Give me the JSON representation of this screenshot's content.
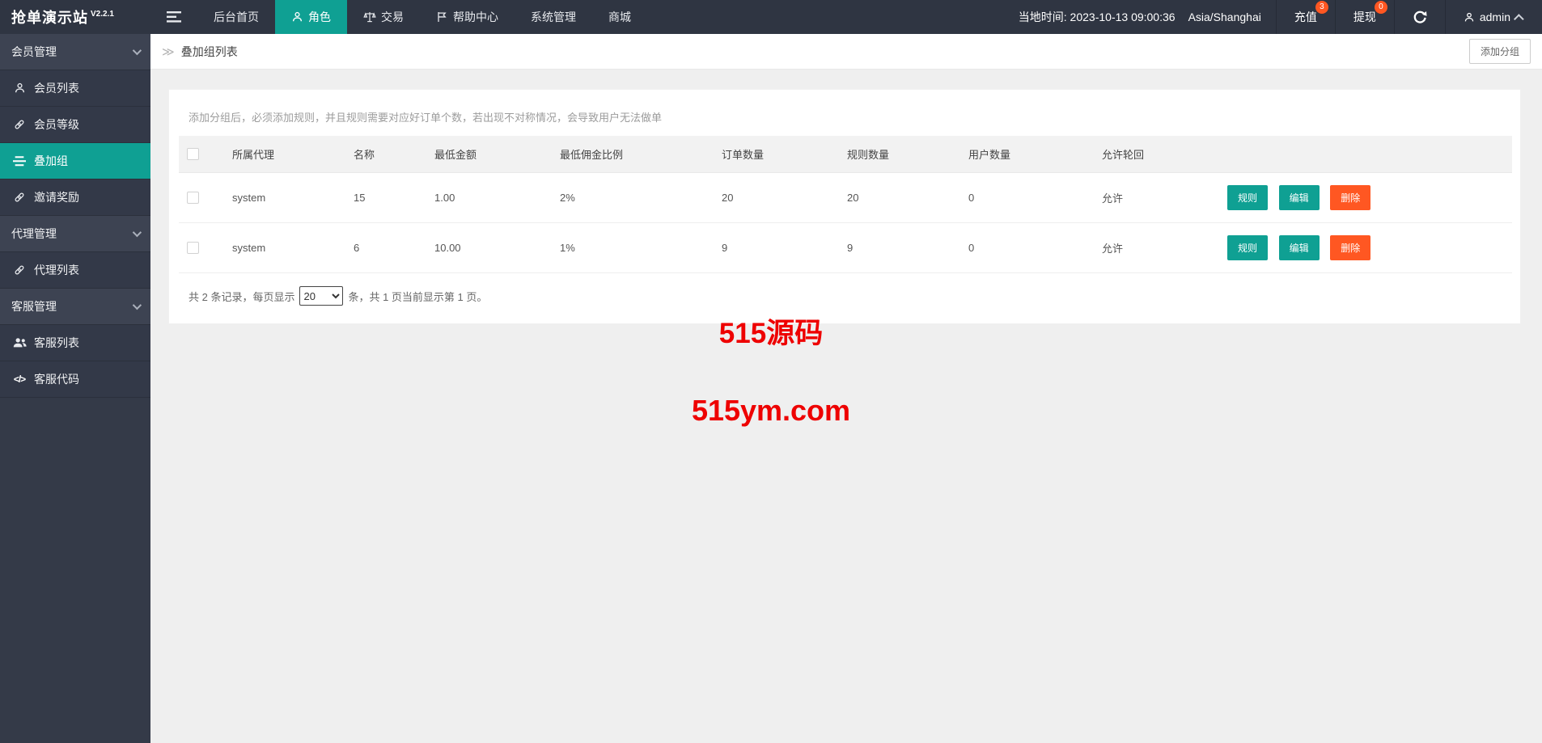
{
  "navbar": {
    "brand": "抢单演示站",
    "version": "V2.2.1",
    "tabs": [
      {
        "label": "后台首页"
      },
      {
        "label": "角色"
      },
      {
        "label": "交易"
      },
      {
        "label": "帮助中心"
      },
      {
        "label": "系统管理"
      },
      {
        "label": "商城"
      }
    ],
    "local_time": "当地时间: 2023-10-13 09:00:36",
    "timezone": "Asia/Shanghai",
    "recharge": {
      "label": "充值",
      "badge": "3"
    },
    "withdraw": {
      "label": "提现",
      "badge": "0"
    },
    "user": "admin"
  },
  "sidebar": {
    "items": [
      {
        "label": "会员管理"
      },
      {
        "label": "会员列表"
      },
      {
        "label": "会员等级"
      },
      {
        "label": "叠加组"
      },
      {
        "label": "邀请奖励"
      },
      {
        "label": "代理管理"
      },
      {
        "label": "代理列表"
      },
      {
        "label": "客服管理"
      },
      {
        "label": "客服列表"
      },
      {
        "label": "客服代码"
      }
    ]
  },
  "breadcrumb": {
    "icon": "≫",
    "title": "叠加组列表",
    "add_button": "添加分组"
  },
  "main": {
    "hint": "添加分组后，必须添加规则，并且规则需要对应好订单个数，若出现不对称情况，会导致用户无法做单",
    "table": {
      "headers": [
        "所属代理",
        "名称",
        "最低金额",
        "最低佣金比例",
        "订单数量",
        "规则数量",
        "用户数量",
        "允许轮回"
      ],
      "rows": [
        {
          "agent": "system",
          "name": "15",
          "min_amount": "1.00",
          "min_commission": "2%",
          "orders": "20",
          "rules": "20",
          "users": "0",
          "loop": "允许"
        },
        {
          "agent": "system",
          "name": "6",
          "min_amount": "10.00",
          "min_commission": "1%",
          "orders": "9",
          "rules": "9",
          "users": "0",
          "loop": "允许"
        }
      ],
      "actions": {
        "rule": "规则",
        "edit": "编辑",
        "delete": "删除"
      }
    },
    "pagination": {
      "prefix": "共 2 条记录，每页显示",
      "page_size": "20",
      "suffix": "条，共 1 页当前显示第 1 页。"
    }
  },
  "watermark": {
    "line1": "515源码",
    "line2": "515ym.com",
    "color": "#ee0000"
  },
  "icons": {
    "code": "</>"
  },
  "colors": {
    "accent": "#0fa093",
    "danger": "#ff5722",
    "navbar_bg": "#2f3542",
    "badge": "#ff5722"
  }
}
